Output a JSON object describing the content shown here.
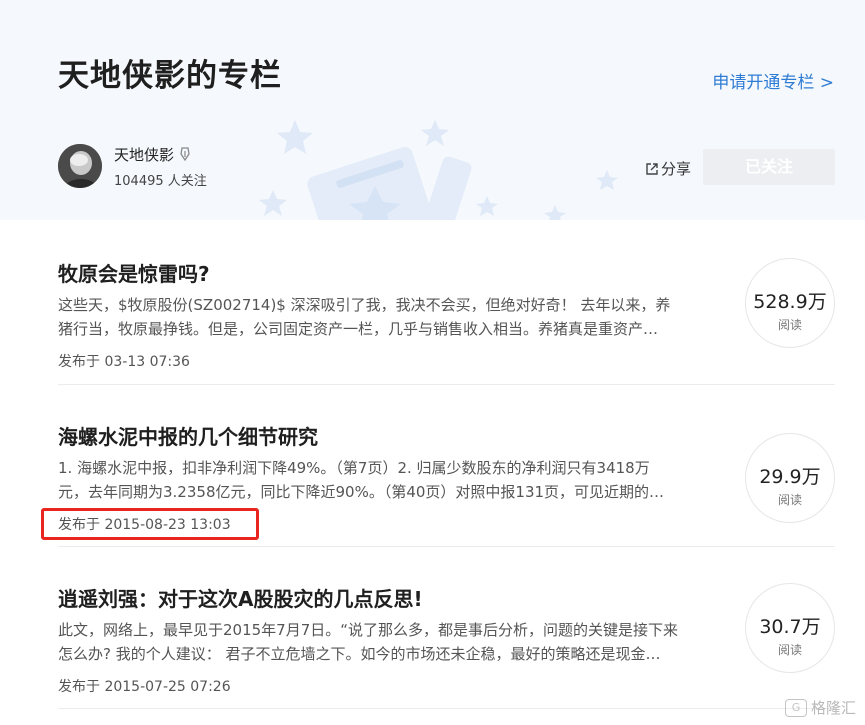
{
  "header": {
    "column_title": "天地侠影的专栏",
    "apply_link": "申请开通专栏 >"
  },
  "author": {
    "name": "天地侠影",
    "followers": "104495 人关注"
  },
  "actions": {
    "share_label": "分享",
    "follow_label": "已关注"
  },
  "articles": [
    {
      "title": "牧原会是惊雷吗?",
      "summary_line1": "这些天，$牧原股份(SZ002714)$ 深深吸引了我，我决不会买，但绝对好奇！ 去年以来，养",
      "summary_line2": "猪行当，牧原最挣钱。但是，公司固定资产一栏，几乎与销售收入相当。养猪真是重资产…",
      "published": "发布于 03-13 07:36",
      "reads": "528.9万",
      "reads_label": "阅读"
    },
    {
      "title": "海螺水泥中报的几个细节研究",
      "summary_line1": "1. 海螺水泥中报，扣非净利润下降49%。（第7页）2. 归属少数股东的净利润只有3418万",
      "summary_line2": "元，去年同期为3.2358亿元，同比下降近90%。（第40页）对照中报131页，可见近期的…",
      "published": "发布于 2015-08-23 13:03",
      "reads": "29.9万",
      "reads_label": "阅读"
    },
    {
      "title": "逍遥刘强：对于这次A股股灾的几点反思!",
      "summary_line1": "此文，网络上，最早见于2015年7月7日。“说了那么多，都是事后分析，问题的关键是接下来",
      "summary_line2": "怎么办? 我的个人建议： 君子不立危墙之下。如今的市场还未企稳，最好的策略还是现金…",
      "published": "发布于 2015-07-25 07:26",
      "reads": "30.7万",
      "reads_label": "阅读"
    }
  ],
  "watermark": {
    "logo_text": "G",
    "text": "格隆汇"
  },
  "colors": {
    "link_blue": "#2e7cd4",
    "highlight_red": "#e8261f",
    "header_bg": "#f5f8fc"
  }
}
